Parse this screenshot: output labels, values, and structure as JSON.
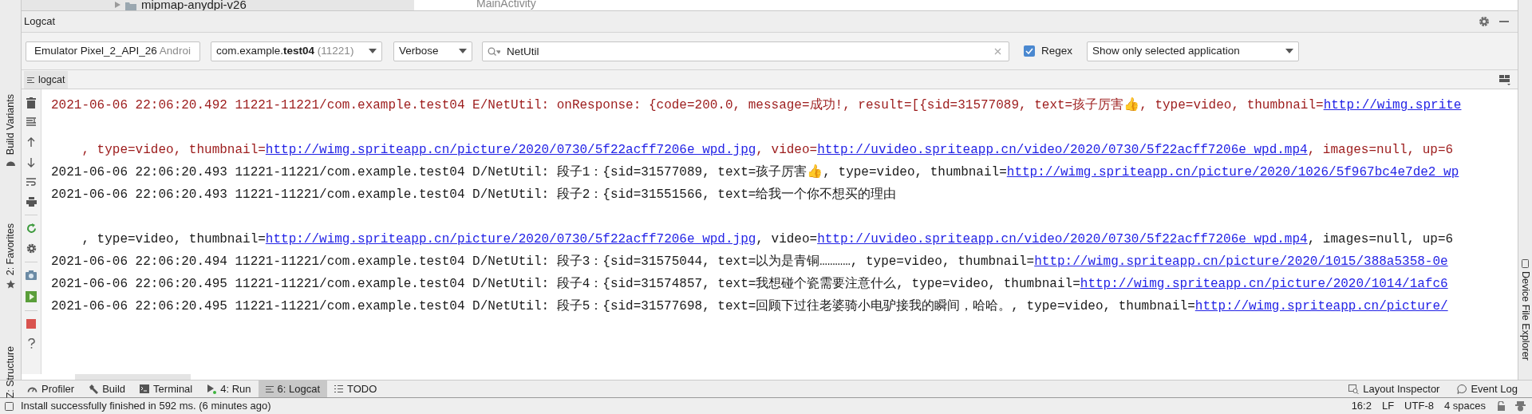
{
  "project_tree_item": {
    "label": "mipmap-anydpi-v26"
  },
  "editor_tab": {
    "label": "MainActivity"
  },
  "left_tool_tabs": [
    {
      "label": "Build Variants"
    },
    {
      "label": "2: Favorites"
    },
    {
      "label": "Z: Structure"
    }
  ],
  "right_tool_tabs": [
    {
      "label": "Device File Explorer"
    }
  ],
  "panel": {
    "title": "Logcat"
  },
  "toolbar": {
    "device": {
      "name": "Emulator Pixel_2_API_26",
      "suffix": "Androi"
    },
    "process": {
      "package": "com.example.**test04**",
      "pid": "(11221)"
    },
    "log_level": "Verbose",
    "search": {
      "value": "NetUtil"
    },
    "regex": {
      "label": "Regex",
      "checked": true
    },
    "filter": "Show only selected application"
  },
  "view_tabs": [
    {
      "label": "logcat",
      "selected": true
    }
  ],
  "log_lines": [
    {
      "kind": "error",
      "segments": [
        {
          "text": "2021-06-06 22:06:20.492 11221-11221/com.example.test04 E/NetUtil: onResponse: {code=200.0, message=成功!, result=[{sid=31577089, text=孩子厉害👍, type=video, thumbnail=",
          "kind": "text"
        },
        {
          "text": "http://wimg.sprite",
          "kind": "link"
        }
      ]
    },
    {
      "kind": "blank"
    },
    {
      "kind": "error",
      "segments": [
        {
          "text": "    , type=video, thumbnail=",
          "kind": "text"
        },
        {
          "text": "http://wimg.spriteapp.cn/picture/2020/0730/5f22acff7206e_wpd.jpg",
          "kind": "link"
        },
        {
          "text": ", video=",
          "kind": "text"
        },
        {
          "text": "http://uvideo.spriteapp.cn/video/2020/0730/5f22acff7206e_wpd.mp4",
          "kind": "link"
        },
        {
          "text": ", images=null, up=6",
          "kind": "text"
        }
      ]
    },
    {
      "kind": "debug",
      "segments": [
        {
          "text": "2021-06-06 22:06:20.493 11221-11221/com.example.test04 D/NetUtil: 段子1：{sid=31577089, text=孩子厉害👍, type=video, thumbnail=",
          "kind": "text"
        },
        {
          "text": "http://wimg.spriteapp.cn/picture/2020/1026/5f967bc4e7de2_wp",
          "kind": "link"
        }
      ]
    },
    {
      "kind": "debug",
      "segments": [
        {
          "text": "2021-06-06 22:06:20.493 11221-11221/com.example.test04 D/NetUtil: 段子2：{sid=31551566, text=给我一个你不想买的理由",
          "kind": "text"
        }
      ]
    },
    {
      "kind": "blank"
    },
    {
      "kind": "debug",
      "segments": [
        {
          "text": "    , type=video, thumbnail=",
          "kind": "text"
        },
        {
          "text": "http://wimg.spriteapp.cn/picture/2020/0730/5f22acff7206e_wpd.jpg",
          "kind": "link"
        },
        {
          "text": ", video=",
          "kind": "text"
        },
        {
          "text": "http://uvideo.spriteapp.cn/video/2020/0730/5f22acff7206e_wpd.mp4",
          "kind": "link"
        },
        {
          "text": ", images=null, up=6",
          "kind": "text"
        }
      ]
    },
    {
      "kind": "debug",
      "segments": [
        {
          "text": "2021-06-06 22:06:20.494 11221-11221/com.example.test04 D/NetUtil: 段子3：{sid=31575044, text=以为是青铜…………, type=video, thumbnail=",
          "kind": "text"
        },
        {
          "text": "http://wimg.spriteapp.cn/picture/2020/1015/388a5358-0e",
          "kind": "link"
        }
      ]
    },
    {
      "kind": "debug",
      "segments": [
        {
          "text": "2021-06-06 22:06:20.495 11221-11221/com.example.test04 D/NetUtil: 段子4：{sid=31574857, text=我想碰个瓷需要注意什么, type=video, thumbnail=",
          "kind": "text"
        },
        {
          "text": "http://wimg.spriteapp.cn/picture/2020/1014/1afc6",
          "kind": "link"
        }
      ]
    },
    {
      "kind": "debug",
      "segments": [
        {
          "text": "2021-06-06 22:06:20.495 11221-11221/com.example.test04 D/NetUtil: 段子5：{sid=31577698, text=回顾下过往老婆骑小电驴接我的瞬间，哈哈。, type=video, thumbnail=",
          "kind": "text"
        },
        {
          "text": "http://wimg.spriteapp.cn/picture/",
          "kind": "link"
        }
      ]
    }
  ],
  "bottom_tabs": [
    {
      "label": "Profiler",
      "kind": "profiler",
      "selected": false
    },
    {
      "label": "Build",
      "kind": "build",
      "selected": false
    },
    {
      "label": "Terminal",
      "kind": "terminal",
      "selected": false
    },
    {
      "label": "4: Run",
      "kind": "run",
      "selected": false
    },
    {
      "label": "6: Logcat",
      "kind": "logcat",
      "selected": true
    },
    {
      "label": "TODO",
      "kind": "todo",
      "selected": false
    }
  ],
  "right_bottom_tabs": [
    {
      "label": "Layout Inspector",
      "kind": "inspector"
    },
    {
      "label": "Event Log",
      "kind": "event-log"
    }
  ],
  "status_bar": {
    "message": "Install successfully finished in 592 ms. (6 minutes ago)",
    "items": [
      "16:2",
      "LF",
      "UTF-8",
      "4 spaces"
    ]
  }
}
